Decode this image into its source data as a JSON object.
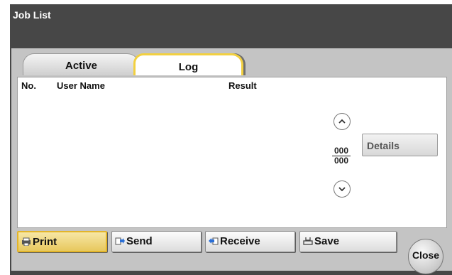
{
  "window": {
    "title": "Job List"
  },
  "tabs": [
    {
      "label": "Active",
      "selected": false
    },
    {
      "label": "Log",
      "selected": true
    }
  ],
  "table": {
    "columns": [
      "No.",
      "User Name",
      "Result"
    ],
    "rows": []
  },
  "pager": {
    "current": "000",
    "total": "000"
  },
  "details_label": "Details",
  "bottom_buttons": [
    {
      "label": "Print",
      "icon": "print-icon",
      "selected": true
    },
    {
      "label": "Send",
      "icon": "send-icon",
      "selected": false
    },
    {
      "label": "Receive",
      "icon": "receive-icon",
      "selected": false
    },
    {
      "label": "Save",
      "icon": "save-icon",
      "selected": false
    }
  ],
  "close_label": "Close",
  "colors": {
    "frame": "#474747",
    "panel": "#c4c4c4",
    "selected_accent": "#f2d040"
  }
}
